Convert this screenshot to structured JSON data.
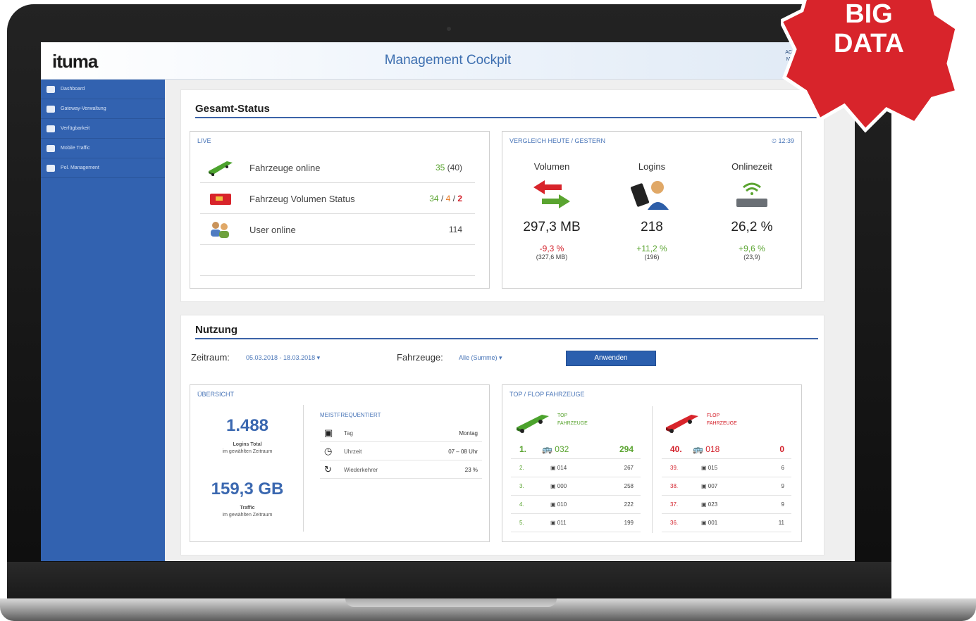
{
  "header": {
    "logo": "ituma",
    "title": "Management Cockpit",
    "account_line1": "ACCESS",
    "account_line2": "Musterkr"
  },
  "sidebar": {
    "items": [
      {
        "label": "Dashboard",
        "icon": "home-icon"
      },
      {
        "label": "Gateway-Verwaltung",
        "icon": "network-icon"
      },
      {
        "label": "Verfügbarkeit",
        "icon": "list-icon"
      },
      {
        "label": "Mobile Traffic",
        "icon": "wifi-icon"
      },
      {
        "label": "Pol. Management",
        "icon": "shield-icon"
      }
    ]
  },
  "gesamt": {
    "title": "Gesamt-Status",
    "live": {
      "label": "LIVE",
      "rows": [
        {
          "label": "Fahrzeuge online",
          "v1": "35",
          "v2": "(40)"
        },
        {
          "label": "Fahrzeug Volumen Status",
          "green": "34",
          "orange": "4",
          "red": "2",
          "sep": "/"
        },
        {
          "label": "User online",
          "value": "114"
        }
      ]
    },
    "vergleich": {
      "label": "VERGLEICH HEUTE / GESTERN",
      "time": "12:39",
      "cols": [
        {
          "head": "Volumen",
          "value": "297,3 MB",
          "pct": "-9,3 %",
          "prev": "(327,6 MB)",
          "color": "#d3202a"
        },
        {
          "head": "Logins",
          "value": "218",
          "pct": "+11,2 %",
          "prev": "(196)",
          "color": "#5aa430"
        },
        {
          "head": "Onlinezeit",
          "value": "26,2 %",
          "pct": "+9,6 %",
          "prev": "(23,9)",
          "color": "#5aa430"
        }
      ]
    }
  },
  "nutzung": {
    "title": "Nutzung",
    "zeitraum_label": "Zeitraum:",
    "zeitraum_value": "05.03.2018 - 18.03.2018 ▾",
    "fahrzeuge_label": "Fahrzeuge:",
    "fahrzeuge_value": "Alle (Summe) ▾",
    "apply_button": "Anwenden",
    "uebersicht": {
      "label": "ÜBERSICHT",
      "logins": "1.488",
      "logins_cap1": "Logins Total",
      "logins_cap2": "im gewählten Zeitraum",
      "traffic": "159,3 GB",
      "traffic_cap1": "Traffic",
      "traffic_cap2": "im gewählten Zeitraum",
      "meist_label": "MEISTFREQUENTIERT",
      "freq": [
        {
          "label": "Tag",
          "value": "Montag",
          "icon": "calendar-icon"
        },
        {
          "label": "Uhrzeit",
          "value": "07 – 08 Uhr",
          "icon": "clock-icon"
        },
        {
          "label": "Wiederkehrer",
          "value": "23 %",
          "icon": "refresh-icon"
        }
      ]
    },
    "topflop": {
      "label": "TOP / FLOP FAHRZEUGE",
      "top_head1": "TOP",
      "top_head2": "FAHRZEUGE",
      "flop_head1": "FLOP",
      "flop_head2": "FAHRZEUGE",
      "top": [
        {
          "rank": "1.",
          "name": "032",
          "value": "294"
        },
        {
          "rank": "2.",
          "name": "014",
          "value": "267"
        },
        {
          "rank": "3.",
          "name": "000",
          "value": "258"
        },
        {
          "rank": "4.",
          "name": "010",
          "value": "222"
        },
        {
          "rank": "5.",
          "name": "011",
          "value": "199"
        }
      ],
      "flop": [
        {
          "rank": "40.",
          "name": "018",
          "value": "0"
        },
        {
          "rank": "39.",
          "name": "015",
          "value": "6"
        },
        {
          "rank": "38.",
          "name": "007",
          "value": "9"
        },
        {
          "rank": "37.",
          "name": "023",
          "value": "9"
        },
        {
          "rank": "36.",
          "name": "001",
          "value": "11"
        }
      ]
    }
  },
  "badge": {
    "line1": "BIG",
    "line2": "DATA",
    "color": "#d8242b"
  }
}
